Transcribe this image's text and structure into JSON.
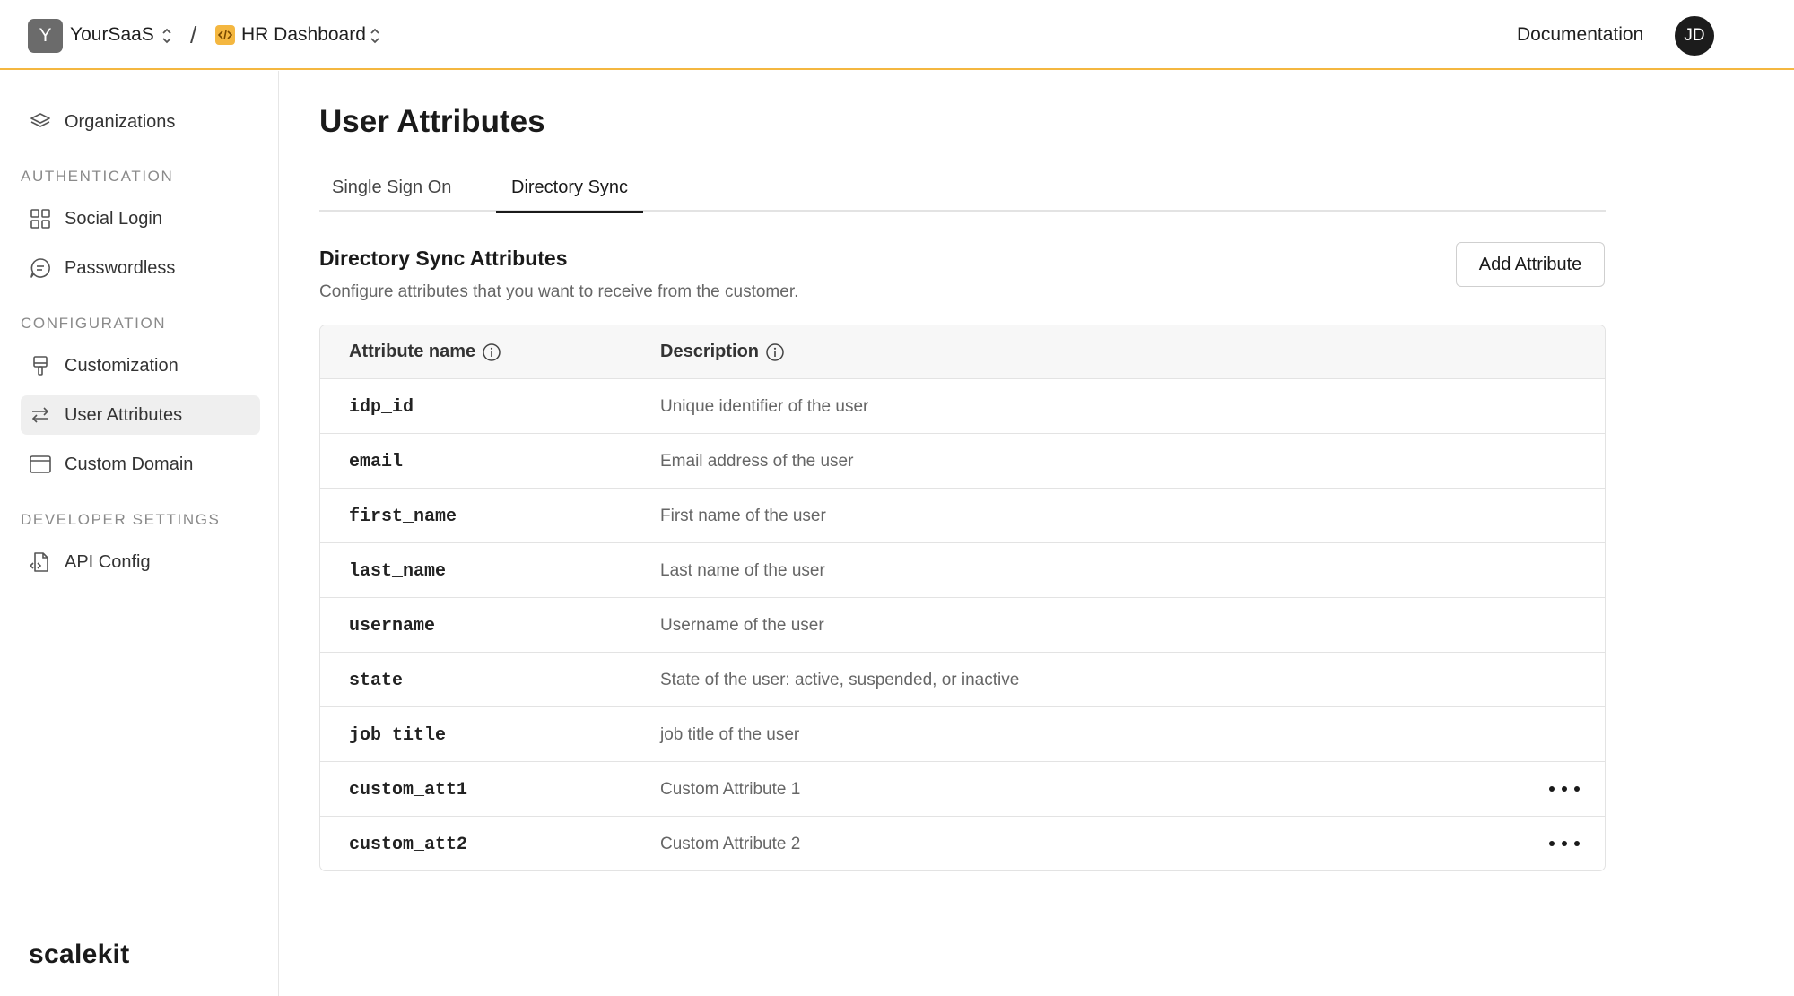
{
  "header": {
    "org_initial": "Y",
    "org_name": "YourSaaS",
    "separator": "/",
    "project_name": "HR Dashboard",
    "documentation_label": "Documentation",
    "user_initials": "JD"
  },
  "sidebar": {
    "items": [
      {
        "label": "Organizations",
        "icon": "layers-icon"
      },
      {
        "label": "Social Login",
        "icon": "grid-icon"
      },
      {
        "label": "Passwordless",
        "icon": "message-icon"
      },
      {
        "label": "Customization",
        "icon": "paintbrush-icon"
      },
      {
        "label": "User Attributes",
        "icon": "arrows-swap-icon",
        "active": true
      },
      {
        "label": "Custom Domain",
        "icon": "browser-window-icon"
      },
      {
        "label": "API Config",
        "icon": "file-code-icon"
      }
    ],
    "sections": {
      "authentication": "AUTHENTICATION",
      "configuration": "CONFIGURATION",
      "developer": "DEVELOPER SETTINGS"
    },
    "brand": "scalekit"
  },
  "main": {
    "title": "User Attributes",
    "tabs": [
      {
        "label": "Single Sign On",
        "active": false
      },
      {
        "label": "Directory Sync",
        "active": true
      }
    ],
    "section_title": "Directory Sync Attributes",
    "section_description": "Configure attributes that you want to receive from the customer.",
    "add_button_label": "Add Attribute",
    "table": {
      "columns": [
        "Attribute name",
        "Description"
      ],
      "rows": [
        {
          "name": "idp_id",
          "description": "Unique identifier of the user"
        },
        {
          "name": "email",
          "description": "Email address of the user"
        },
        {
          "name": "first_name",
          "description": "First name of the user"
        },
        {
          "name": "last_name",
          "description": "Last name of the user"
        },
        {
          "name": "username",
          "description": "Username of the user"
        },
        {
          "name": "state",
          "description": "State of the user: active, suspended, or inactive"
        },
        {
          "name": "job_title",
          "description": "job title of the user"
        },
        {
          "name": "custom_att1",
          "description": "Custom Attribute 1",
          "has_menu": true
        },
        {
          "name": "custom_att2",
          "description": "Custom Attribute 2",
          "has_menu": true
        }
      ]
    }
  },
  "colors": {
    "accent": "#f4b740",
    "active_item_bg": "#efefef",
    "avatar_dark": "#1c1c1c"
  }
}
